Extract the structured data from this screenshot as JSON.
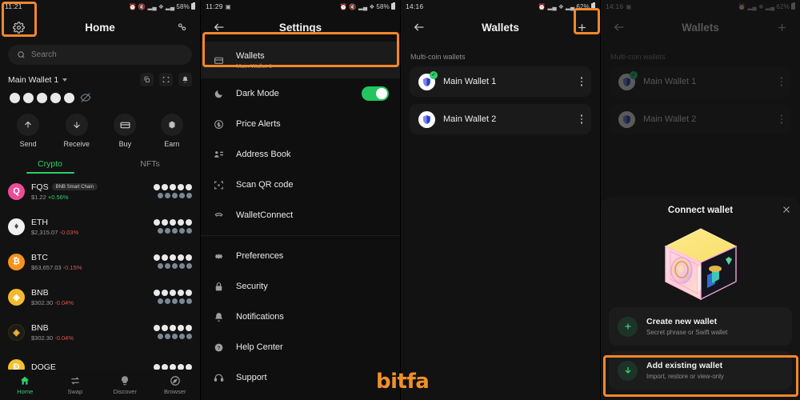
{
  "panel1": {
    "status": {
      "time": "11:21",
      "battery": "58%",
      "icons": [
        "alarm-icon",
        "mute-icon",
        "signal-icon",
        "wifi-icon",
        "signal2-icon"
      ]
    },
    "header": {
      "title": "Home",
      "gear_icon": "gear-icon",
      "scan_icon": "scan-icon"
    },
    "search": {
      "placeholder": "Search",
      "icon": "search-icon"
    },
    "wallet": {
      "name": "Main Wallet 1",
      "icons": [
        "copy-icon",
        "qr-icon",
        "bell-icon"
      ]
    },
    "balance_hidden": true,
    "balance_dots": 5,
    "eye_icon": "eye-off-icon",
    "actions": [
      {
        "label": "Send",
        "icon": "arrow-up-icon"
      },
      {
        "label": "Receive",
        "icon": "arrow-down-icon"
      },
      {
        "label": "Buy",
        "icon": "card-icon"
      },
      {
        "label": "Earn",
        "icon": "earn-icon"
      }
    ],
    "tabs": [
      {
        "label": "Crypto",
        "active": true
      },
      {
        "label": "NFTs",
        "active": false
      }
    ],
    "assets": [
      {
        "symbol": "FQS",
        "chip": "BNB Smart Chain",
        "price": "$1.22",
        "change": "+0.56%",
        "dir": "up",
        "color": "#ee4c9a"
      },
      {
        "symbol": "ETH",
        "chip": "",
        "price": "$2,315.07",
        "change": "-0.03%",
        "dir": "down",
        "color": "#f0f0f0"
      },
      {
        "symbol": "BTC",
        "chip": "",
        "price": "$63,657.03",
        "change": "-0.15%",
        "dir": "down",
        "color": "#f7931a"
      },
      {
        "symbol": "BNB",
        "chip": "",
        "price": "$302.30",
        "change": "-0.04%",
        "dir": "down",
        "color": "#f3ba2f"
      },
      {
        "symbol": "BNB",
        "chip": "",
        "price": "$302.30",
        "change": "-0.04%",
        "dir": "down",
        "color": "#1c1c1c"
      },
      {
        "symbol": "DOGE",
        "chip": "",
        "price": "",
        "change": "",
        "dir": "",
        "color": "#f2c230"
      }
    ],
    "nav": [
      {
        "label": "Home",
        "icon": "home-icon",
        "active": true
      },
      {
        "label": "Swap",
        "icon": "swap-icon",
        "active": false
      },
      {
        "label": "Discover",
        "icon": "bulb-icon",
        "active": false
      },
      {
        "label": "Browser",
        "icon": "compass-icon",
        "active": false
      }
    ]
  },
  "panel2": {
    "status": {
      "time": "11:29",
      "battery": "58%"
    },
    "header": {
      "title": "Settings",
      "back_icon": "back-arrow-icon"
    },
    "items": [
      {
        "label": "Wallets",
        "sub": "Main Wallet 1",
        "icon": "wallet-icon",
        "selected": true
      },
      {
        "label": "Dark Mode",
        "sub": "",
        "icon": "moon-icon",
        "toggle": true,
        "toggle_on": true
      },
      {
        "label": "Price Alerts",
        "sub": "",
        "icon": "dollar-icon"
      },
      {
        "label": "Address Book",
        "sub": "",
        "icon": "contacts-icon"
      },
      {
        "label": "Scan QR code",
        "sub": "",
        "icon": "qr-scan-icon"
      },
      {
        "label": "WalletConnect",
        "sub": "",
        "icon": "walletconnect-icon"
      },
      {
        "label": "Preferences",
        "sub": "",
        "icon": "gear-icon"
      },
      {
        "label": "Security",
        "sub": "",
        "icon": "lock-icon"
      },
      {
        "label": "Notifications",
        "sub": "",
        "icon": "bell-icon"
      },
      {
        "label": "Help Center",
        "sub": "",
        "icon": "question-icon"
      },
      {
        "label": "Support",
        "sub": "",
        "icon": "headset-icon"
      }
    ]
  },
  "panel3": {
    "status": {
      "time": "14:16",
      "battery": "62%"
    },
    "header": {
      "title": "Wallets",
      "back_icon": "back-arrow-icon",
      "add_icon": "plus-icon"
    },
    "section_label": "Multi-coin wallets",
    "wallets": [
      {
        "name": "Main Wallet 1",
        "checked": true
      },
      {
        "name": "Main Wallet 2",
        "checked": false
      }
    ]
  },
  "panel4": {
    "status": {
      "time": "14:16",
      "battery": "62%"
    },
    "header": {
      "title": "Wallets",
      "back_icon": "back-arrow-icon",
      "add_icon": "plus-icon"
    },
    "section_label": "Multi-coin wallets",
    "wallets": [
      {
        "name": "Main Wallet 1",
        "checked": true
      },
      {
        "name": "Main Wallet 2",
        "checked": false
      }
    ],
    "sheet": {
      "title": "Connect wallet",
      "close_icon": "close-icon",
      "illustration": "safe-vault-illustration",
      "options": [
        {
          "title": "Create new wallet",
          "sub": "Secret phrase or Swift wallet",
          "icon": "plus-icon"
        },
        {
          "title": "Add existing wallet",
          "sub": "Import, restore or view-only",
          "icon": "download-icon",
          "highlighted": true
        }
      ]
    }
  },
  "watermark": {
    "text": "bitfa",
    "color": "#f0902a"
  },
  "highlight_color": "#f2872c"
}
